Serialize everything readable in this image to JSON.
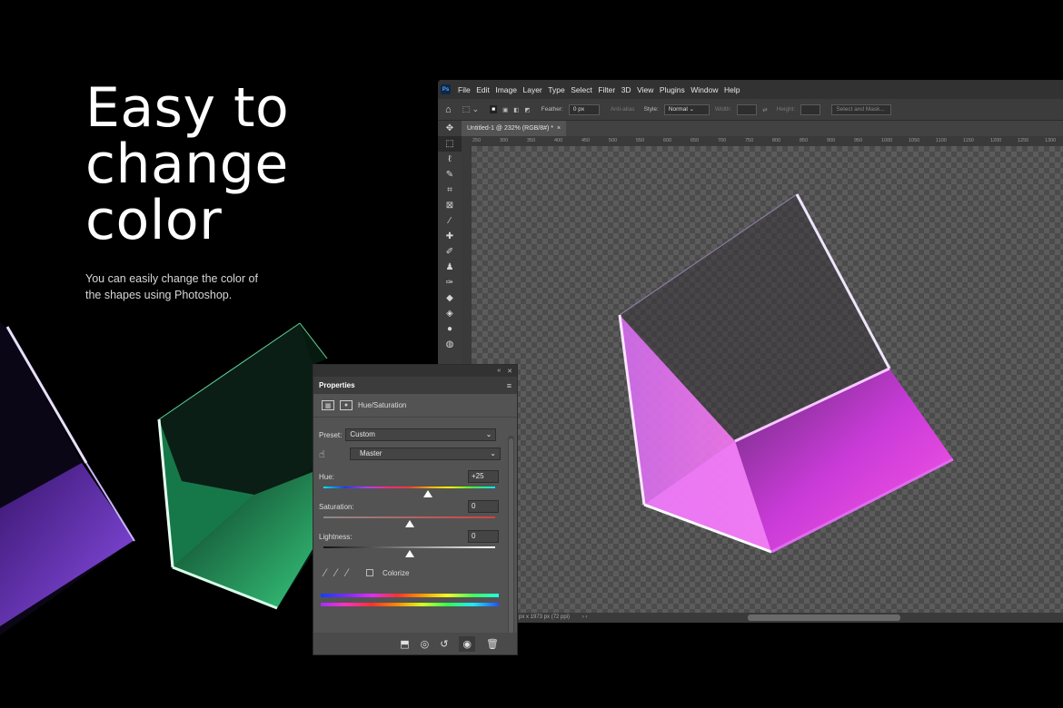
{
  "hero": {
    "title_line1": "Easy to",
    "title_line2": "change",
    "title_line3": "color",
    "subtitle": "You can easily change the color of the shapes using Photoshop."
  },
  "photoshop": {
    "logo": "Ps",
    "menu": [
      "File",
      "Edit",
      "Image",
      "Layer",
      "Type",
      "Select",
      "Filter",
      "3D",
      "View",
      "Plugins",
      "Window",
      "Help"
    ],
    "options": {
      "feather_label": "Feather:",
      "feather_value": "0 px",
      "anti_alias_label": "Anti-alias",
      "style_label": "Style:",
      "style_value": "Normal",
      "width_label": "Width:",
      "height_label": "Height:",
      "select_mask_label": "Select and Mask..."
    },
    "doc_tab": "Untitled-1 @ 232% (RGB/8#) *",
    "doc_tab_close": "×",
    "ruler_ticks": [
      "250",
      "300",
      "350",
      "400",
      "450",
      "500",
      "550",
      "600",
      "650",
      "700",
      "750",
      "800",
      "850",
      "900",
      "950",
      "1000",
      "1050",
      "1100",
      "1150",
      "1200",
      "1250",
      "1300"
    ],
    "status_text": "px x 1973 px (72 ppi)",
    "status_arrows": "›   ‹"
  },
  "properties": {
    "title": "Properties",
    "adjustment_name": "Hue/Saturation",
    "preset_label": "Preset:",
    "preset_value": "Custom",
    "channel_value": "Master",
    "hue_label": "Hue:",
    "hue_value": "+25",
    "hue_level": 0.61,
    "saturation_label": "Saturation:",
    "saturation_value": "0",
    "saturation_level": 0.5,
    "lightness_label": "Lightness:",
    "lightness_value": "0",
    "lightness_level": 0.5,
    "colorize_label": "Colorize",
    "colorize_checked": false
  },
  "colors": {
    "accent_purple": "#b84fe0",
    "accent_green": "#2fb86a",
    "panel_bg": "#535353"
  }
}
